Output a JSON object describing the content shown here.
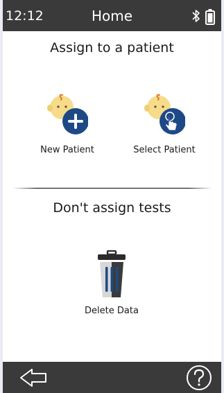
{
  "status_bar": {
    "time": "12:12",
    "title": "Home",
    "icons": [
      "bluetooth-icon",
      "battery-icon"
    ]
  },
  "assign_section": {
    "heading": "Assign to a patient",
    "new_patient": {
      "label": "New Patient",
      "icon": "baby-add-icon"
    },
    "select_patient": {
      "label": "Select Patient",
      "icon": "baby-select-icon"
    }
  },
  "no_assign_section": {
    "heading": "Don't assign tests",
    "delete_data": {
      "label": "Delete Data",
      "icon": "trash-icon"
    }
  },
  "bottom_bar": {
    "icons": [
      "back-arrow-icon",
      "help-icon"
    ]
  },
  "colors": {
    "bar": "#3a3a3a",
    "accent_blue": "#1d4a86",
    "baby_face": "#f6dc8a",
    "background": "#ffffff"
  }
}
